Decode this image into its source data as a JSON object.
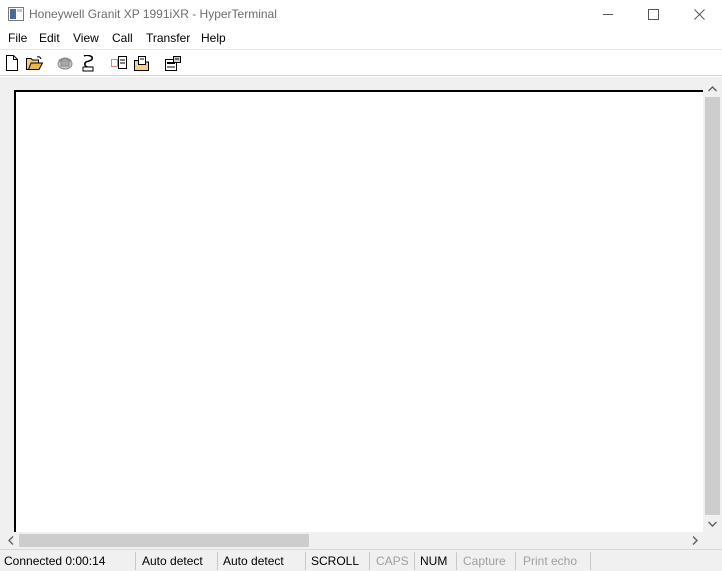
{
  "window": {
    "title": "Honeywell Granit XP 1991iXR - HyperTerminal",
    "icon": "hyperterminal-app-icon"
  },
  "menu": {
    "items": [
      {
        "label": "File"
      },
      {
        "label": "Edit"
      },
      {
        "label": "View"
      },
      {
        "label": "Call"
      },
      {
        "label": "Transfer"
      },
      {
        "label": "Help"
      }
    ]
  },
  "toolbar": {
    "buttons": [
      {
        "icon": "new-document-icon"
      },
      {
        "icon": "open-folder-icon"
      },
      {
        "icon": "call-phone-icon"
      },
      {
        "icon": "disconnect-icon"
      },
      {
        "icon": "send-file-icon"
      },
      {
        "icon": "receive-file-icon"
      },
      {
        "icon": "properties-icon"
      }
    ]
  },
  "terminal": {
    "content": ""
  },
  "statusbar": {
    "connected": "Connected 0:00:14",
    "detect1": "Auto detect",
    "detect2": "Auto detect",
    "scroll": "SCROLL",
    "caps": "CAPS",
    "num": "NUM",
    "capture": "Capture",
    "print_echo": "Print echo"
  },
  "colors": {
    "frame_bg": "#f0f0f0",
    "scroll_thumb": "#cdcdcd",
    "disabled_text": "#a0a0a0"
  }
}
